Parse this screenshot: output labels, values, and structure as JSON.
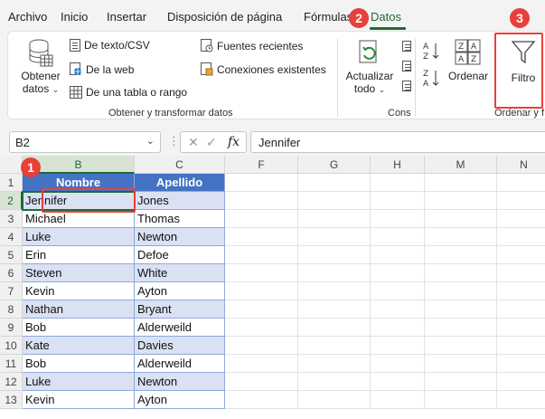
{
  "menu": {
    "tabs": [
      "Archivo",
      "Inicio",
      "Insertar",
      "Disposición de página",
      "Fórmulas",
      "Datos"
    ],
    "active": "Datos"
  },
  "ribbon": {
    "obtener_datos": "Obtener\ndatos",
    "obtener_line1": "Obtener",
    "obtener_line2": "datos",
    "de_texto": "De texto/CSV",
    "de_web": "De la web",
    "de_tabla": "De una tabla o rango",
    "fuentes": "Fuentes recientes",
    "conexiones": "Conexiones existentes",
    "group1_label": "Obtener y transformar datos",
    "actualizar_line1": "Actualizar",
    "actualizar_line2": "todo",
    "group2_label": "Cons",
    "ordenar": "Ordenar",
    "filtro": "Filtro",
    "group3_label": "Ordenar y f"
  },
  "formula_bar": {
    "name_box": "B2",
    "value": "Jennifer"
  },
  "grid": {
    "columns": [
      "B",
      "C",
      "F",
      "G",
      "H",
      "M",
      "N"
    ],
    "rows": [
      "1",
      "2",
      "3",
      "4",
      "5",
      "6",
      "7",
      "8",
      "9",
      "10",
      "11",
      "12",
      "13"
    ],
    "header": [
      "Nombre",
      "Apellido"
    ],
    "data": [
      [
        "Jennifer",
        "Jones"
      ],
      [
        "Michael",
        "Thomas"
      ],
      [
        "Luke",
        "Newton"
      ],
      [
        "Erin",
        "Defoe"
      ],
      [
        "Steven",
        "White"
      ],
      [
        "Kevin",
        "Ayton"
      ],
      [
        "Nathan",
        "Bryant"
      ],
      [
        "Bob",
        "Alderweild"
      ],
      [
        "Kate",
        "Davies"
      ],
      [
        "Bob",
        "Alderweild"
      ],
      [
        "Luke",
        "Newton"
      ],
      [
        "Kevin",
        "Ayton"
      ]
    ]
  },
  "badges": [
    "1",
    "2",
    "3"
  ],
  "colors": {
    "accent_green": "#1e6b34",
    "table_header": "#4472c4",
    "table_band": "#d9e1f2",
    "annotation_red": "#e8403a"
  }
}
